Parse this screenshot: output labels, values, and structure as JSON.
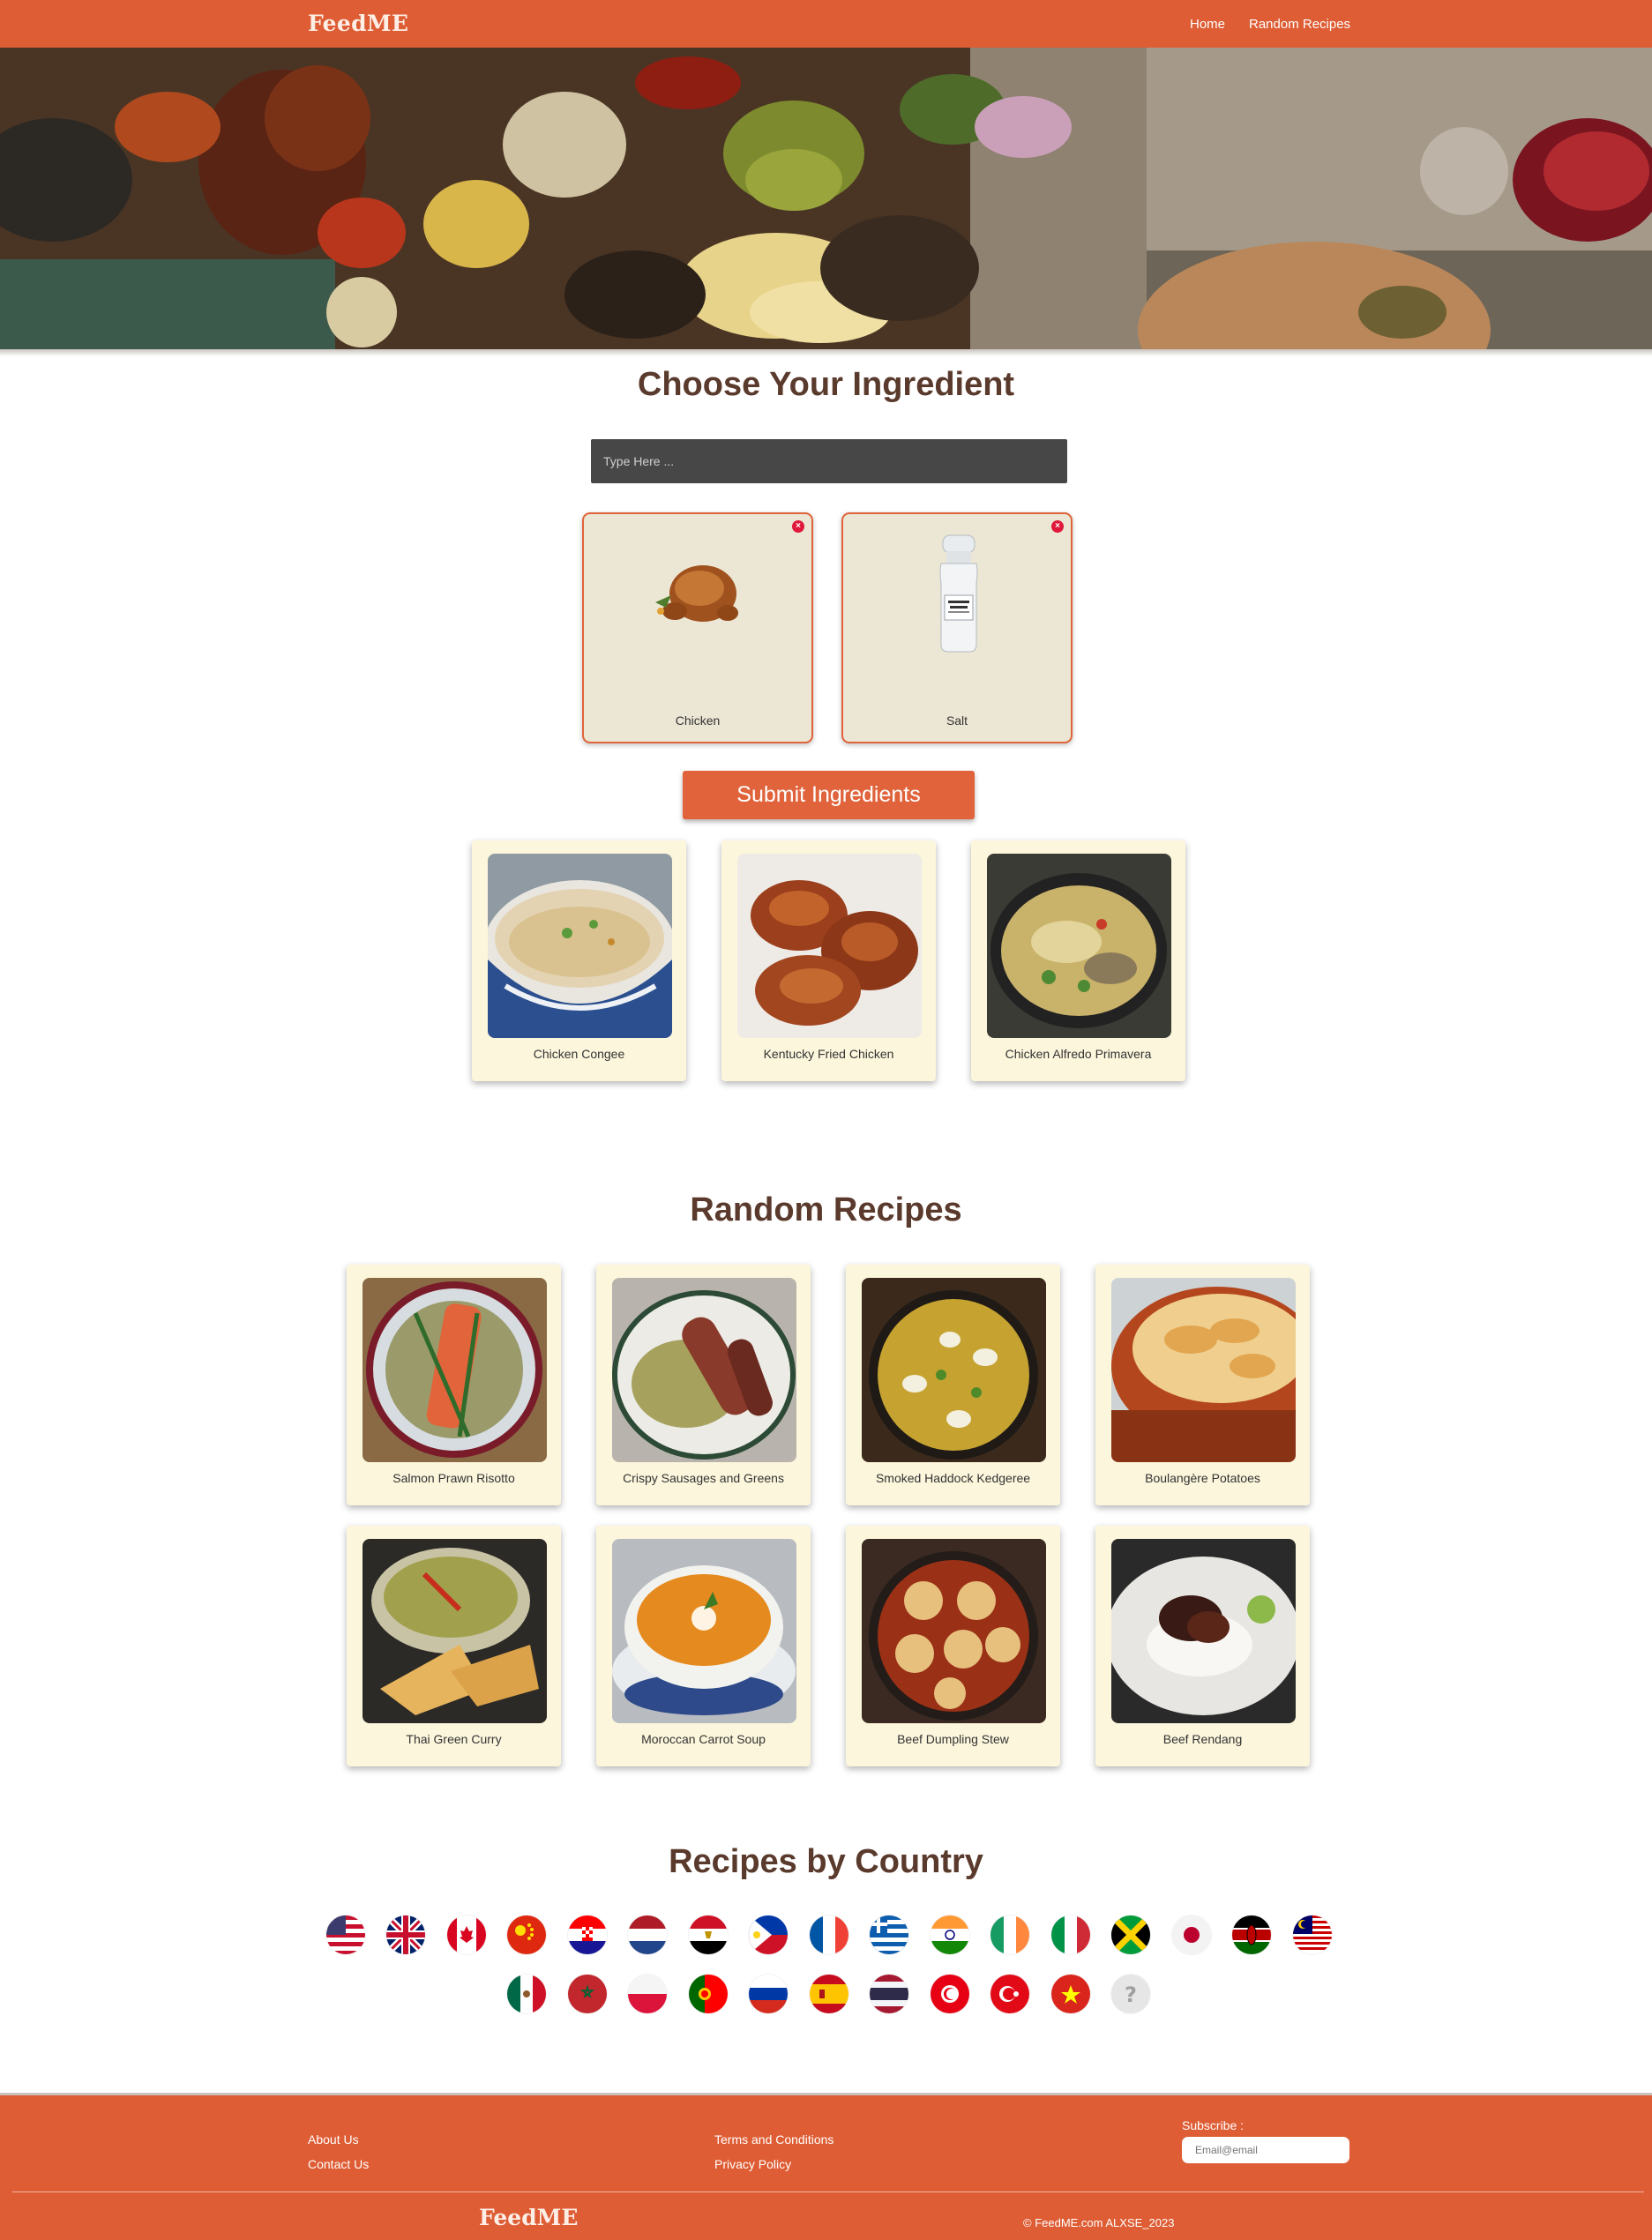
{
  "nav": {
    "brand": "FeedME",
    "links": [
      "Home",
      "Random Recipes"
    ]
  },
  "ingredient_section": {
    "title": "Choose Your Ingredient",
    "search_placeholder": "Type Here ...",
    "selected": [
      {
        "name": "Chicken",
        "icon": "roast-chicken"
      },
      {
        "name": "Salt",
        "icon": "salt-shaker"
      }
    ],
    "submit_label": "Submit Ingredients",
    "results": [
      {
        "name": "Chicken Congee",
        "image": "chicken-congee-photo"
      },
      {
        "name": "Kentucky Fried Chicken",
        "image": "fried-chicken-photo"
      },
      {
        "name": "Chicken Alfredo Primavera",
        "image": "chicken-alfredo-photo"
      }
    ]
  },
  "random_section": {
    "title": "Random Recipes",
    "recipes": [
      {
        "name": "Salmon Prawn Risotto",
        "image": "salmon-risotto-photo"
      },
      {
        "name": "Crispy Sausages and Greens",
        "image": "sausages-greens-photo"
      },
      {
        "name": "Smoked Haddock Kedgeree",
        "image": "kedgeree-photo"
      },
      {
        "name": "Boulangère Potatoes",
        "image": "boulangere-potatoes-photo"
      },
      {
        "name": "Thai Green Curry",
        "image": "thai-green-curry-photo"
      },
      {
        "name": "Moroccan Carrot Soup",
        "image": "carrot-soup-photo"
      },
      {
        "name": "Beef Dumpling Stew",
        "image": "dumpling-stew-photo"
      },
      {
        "name": "Beef Rendang",
        "image": "beef-rendang-photo"
      }
    ]
  },
  "country_section": {
    "title": "Recipes by Country",
    "flags": [
      "usa-flag-icon",
      "uk-flag-icon",
      "canada-flag-icon",
      "china-flag-icon",
      "croatia-flag-icon",
      "netherlands-flag-icon",
      "egypt-flag-icon",
      "philippines-flag-icon",
      "france-flag-icon",
      "greece-flag-icon",
      "india-flag-icon",
      "ireland-flag-icon",
      "italy-flag-icon",
      "jamaica-flag-icon",
      "japan-flag-icon",
      "kenya-flag-icon",
      "malaysia-flag-icon",
      "mexico-flag-icon",
      "morocco-flag-icon",
      "poland-flag-icon",
      "portugal-flag-icon",
      "russia-flag-icon",
      "spain-flag-icon",
      "thailand-flag-icon",
      "tunisia-flag-icon",
      "turkey-flag-icon",
      "vietnam-flag-icon",
      "unknown-flag-icon"
    ]
  },
  "footer": {
    "links_left": [
      "About Us",
      "Contact Us"
    ],
    "links_right": [
      "Terms and Conditions",
      "Privacy Policy"
    ],
    "subscribe_label": "Subscribe :",
    "email_placeholder": "Email@email",
    "brand": "FeedME",
    "copyright": "© FeedME.com ALXSE_2023"
  },
  "colors": {
    "primary": "#de5d34",
    "heading": "#5a3a2c",
    "card_bg": "#fcf6dc",
    "ingredient_bg": "#ece6d4",
    "search_bg": "#474747"
  }
}
